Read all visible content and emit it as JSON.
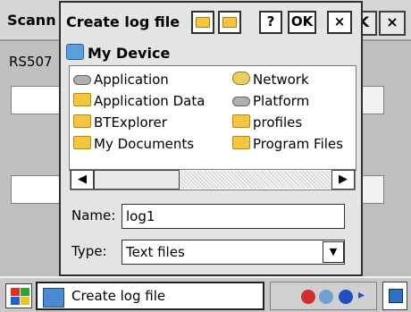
{
  "background_app": {
    "title": "Scann",
    "close_label_left": "K",
    "close_label_right": "×",
    "subtext": "RS507"
  },
  "dialog": {
    "title": "Create log file",
    "help_label": "?",
    "ok_label": "OK",
    "close_label": "×",
    "location": "My Device",
    "files": [
      {
        "name": "Application",
        "icon": "drive-icon"
      },
      {
        "name": "Application Data",
        "icon": "folder-icon"
      },
      {
        "name": "BTExplorer",
        "icon": "folder-icon"
      },
      {
        "name": "My Documents",
        "icon": "folder-icon"
      },
      {
        "name": "Network",
        "icon": "network-icon"
      },
      {
        "name": "Platform",
        "icon": "drive-icon"
      },
      {
        "name": "profiles",
        "icon": "folder-icon"
      },
      {
        "name": "Program Files",
        "icon": "folder-icon"
      }
    ],
    "name_label": "Name:",
    "name_value": "log1",
    "type_label": "Type:",
    "type_value": "Text files"
  },
  "taskbar": {
    "task_label": "Create log file"
  }
}
